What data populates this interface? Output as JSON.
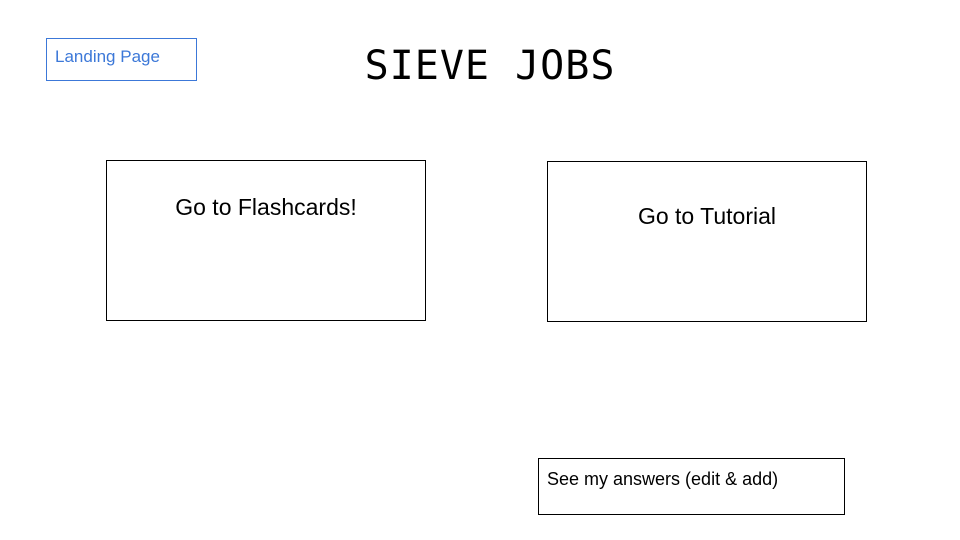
{
  "page_label": "Landing Page",
  "app_title": "SIEVE JOBS",
  "cards": {
    "flashcards": "Go to Flashcards!",
    "tutorial": "Go to Tutorial"
  },
  "answers": {
    "label": "See my answers (edit & add)"
  },
  "colors": {
    "accent": "#3c78d8",
    "border": "#000000",
    "background": "#ffffff"
  }
}
